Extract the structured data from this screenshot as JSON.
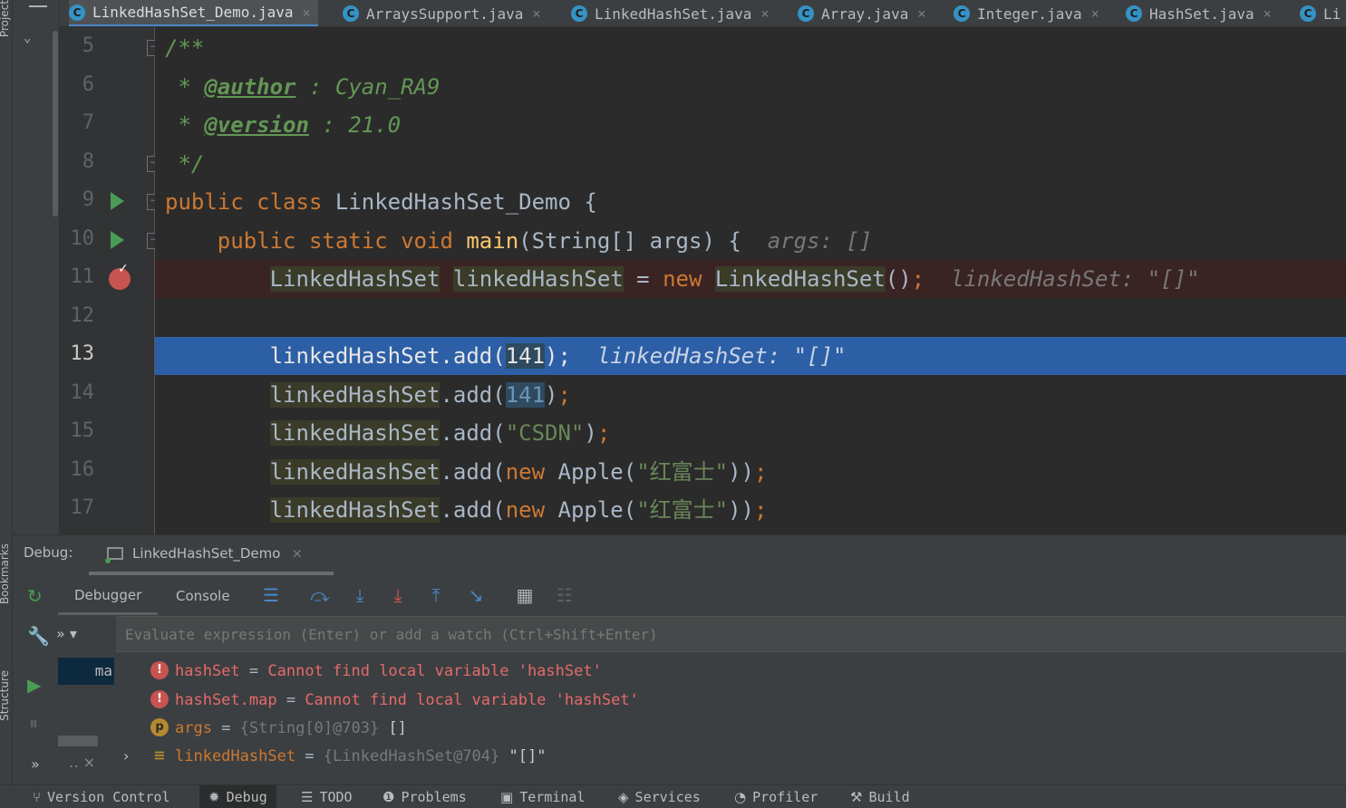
{
  "tabs": [
    {
      "label": "LinkedHashSet_Demo.java",
      "icon": "C",
      "active": true
    },
    {
      "label": "ArraysSupport.java",
      "icon": "C"
    },
    {
      "label": "LinkedHashSet.java",
      "icon": "C"
    },
    {
      "label": "Array.java",
      "icon": "C"
    },
    {
      "label": "Integer.java",
      "icon": "C"
    },
    {
      "label": "HashSet.java",
      "icon": "C"
    },
    {
      "label": "Li",
      "icon": "C"
    }
  ],
  "tab_close": "×",
  "left_strip": {
    "project": "Project",
    "bookmarks": "Bookmarks",
    "structure": "Structure"
  },
  "gutter": {
    "lines": [
      "5",
      "6",
      "7",
      "8",
      "9",
      "10",
      "11",
      "12",
      "13",
      "14",
      "15",
      "16",
      "17"
    ]
  },
  "code": {
    "l5": "/**",
    "l6_star": " * ",
    "l6_tag": "@author",
    "l6_rest": " : Cyan_RA9",
    "l7_star": " * ",
    "l7_tag": "@version",
    "l7_rest": " : 21.0",
    "l8": " */",
    "l9_kw1": "public",
    "l9_kw2": "class",
    "l9_name": "LinkedHashSet_Demo {",
    "l10_kw1": "public",
    "l10_kw2": "static",
    "l10_kw3": "void",
    "l10_fn": "main",
    "l10_rest": "(String[] args) {",
    "l10_inline": "args: []",
    "l11_type": "LinkedHashSet",
    "l11_var": "linkedHashSet",
    "l11_eq": " = ",
    "l11_new": "new",
    "l11_ctor": "LinkedHashSet",
    "l11_end": "()",
    "l11_semi": ";",
    "l11_inline": "linkedHashSet: \"[]\"",
    "l13_call": "linkedHashSet.add(",
    "l13_num": "141",
    "l13_end": ");",
    "l13_inline": "linkedHashSet: \"[]\"",
    "l14_obj": "linkedHashSet",
    "l14_call": ".add(",
    "l14_num": "141",
    "l14_end": ")",
    "l14_semi": ";",
    "l15_obj": "linkedHashSet",
    "l15_call": ".add(",
    "l15_str": "\"CSDN\"",
    "l15_end": ")",
    "l15_semi": ";",
    "l16_obj": "linkedHashSet",
    "l16_call": ".add(",
    "l16_new": "new",
    "l16_cls": " Apple(",
    "l16_str": "\"红富士\"",
    "l16_end": "))",
    "l16_semi": ";",
    "l17_obj": "linkedHashSet",
    "l17_call": ".add(",
    "l17_new": "new",
    "l17_cls": " Apple(",
    "l17_str": "\"红富士\"",
    "l17_end": "))",
    "l17_semi": ";"
  },
  "debug": {
    "label": "Debug:",
    "session": "LinkedHashSet_Demo",
    "tabs": [
      "Debugger",
      "Console"
    ],
    "watch_placeholder": "Evaluate expression (Enter) or add a watch (Ctrl+Shift+Enter)",
    "watch_arrows": "»  ▾",
    "frame_selected": "ma",
    "frame_more": "‥ ×",
    "variables": [
      {
        "icon": "!",
        "name": "hashSet",
        "eq": " = ",
        "value": "Cannot find local variable 'hashSet'"
      },
      {
        "icon": "!",
        "name": "hashSet.map",
        "eq": " = ",
        "value": "Cannot find local variable 'hashSet'"
      },
      {
        "icon": "p",
        "name": "args",
        "eq": " = ",
        "type": "{String[0]@703}",
        "value": " []"
      },
      {
        "icon": "≡",
        "name": "linkedHashSet",
        "eq": " = ",
        "type": "{LinkedHashSet@704}",
        "value": " \"[]\""
      }
    ]
  },
  "status_bar": [
    {
      "label": "Version Control",
      "icon": "⑂"
    },
    {
      "label": "Debug",
      "icon": "✹",
      "active": true
    },
    {
      "label": "TODO",
      "icon": "☰"
    },
    {
      "label": "Problems",
      "icon": "❶"
    },
    {
      "label": "Terminal",
      "icon": "▣"
    },
    {
      "label": "Services",
      "icon": "◈"
    },
    {
      "label": "Profiler",
      "icon": "◔"
    },
    {
      "label": "Build",
      "icon": "⚒"
    }
  ],
  "colors": {
    "accent": "#4a88c7",
    "exec_line": "#2d5fa6",
    "breakpoint": "#c75450",
    "run": "#499c54"
  }
}
